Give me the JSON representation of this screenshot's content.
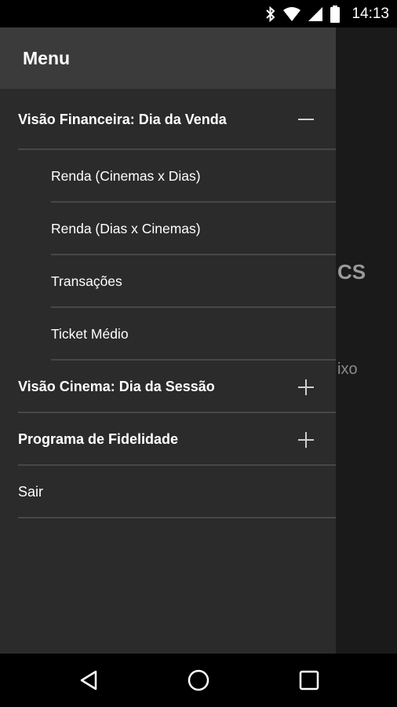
{
  "status_bar": {
    "time": "14:13",
    "icons": [
      "bluetooth-icon",
      "wifi-icon",
      "cell-signal-icon",
      "battery-icon"
    ]
  },
  "background": {
    "title_fragment": "CS",
    "text_fragment": "ixo"
  },
  "drawer": {
    "title": "Menu",
    "groups": [
      {
        "label": "Visão Financeira: Dia da Venda",
        "expanded": true,
        "toggle_icon": "minus-icon",
        "items": [
          "Renda (Cinemas x Dias)",
          "Renda (Dias x Cinemas)",
          "Transações",
          "Ticket Médio"
        ]
      },
      {
        "label": "Visão Cinema: Dia da Sessão",
        "expanded": false,
        "toggle_icon": "plus-icon"
      },
      {
        "label": "Programa de Fidelidade",
        "expanded": false,
        "toggle_icon": "plus-icon"
      }
    ],
    "logout_label": "Sair"
  },
  "nav_bar": {
    "icons": [
      "back-icon",
      "home-icon",
      "recents-icon"
    ]
  },
  "colors": {
    "drawer_bg": "#2b2b2b",
    "header_bg": "#3b3b3b",
    "divider": "#474747",
    "text": "#ffffff"
  }
}
